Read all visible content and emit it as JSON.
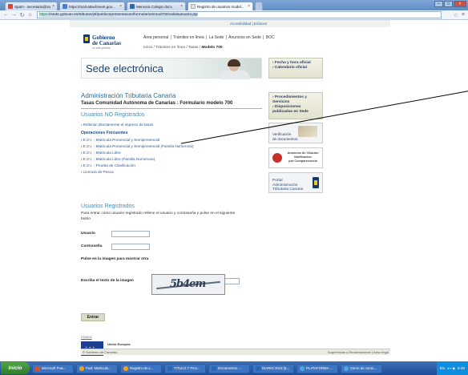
{
  "browser": {
    "tabs": [
      {
        "label": "Spam - secretaria@saladino...",
        "favicon_color": "#d44638"
      },
      {
        "label": "https://mail-attachment.goo...",
        "favicon_color": "#4a7dd1"
      },
      {
        "label": "Memoria Colegio docx",
        "favicon_color": "#2c67b5"
      },
      {
        "label": "Registro de usuarios model...",
        "favicon_color": "#e3e3e3"
      }
    ],
    "url_https": "https",
    "url_rest": "://sede.gobcan.es/tributos/jsf/publico/presentacion/formularios/mod700/validausuario.jsp"
  },
  "site": {
    "access_links": "Accesibilidad | Enlaces",
    "logo": {
      "line1": "Gobierno",
      "line2": "de Canarias",
      "tagline": "un solo pueblo"
    },
    "topnav": [
      "Área personal",
      "Trámites en línea",
      "La Sede",
      "Anuncios en Sede",
      "BOC"
    ],
    "topnav_sep": "|",
    "breadcrumb_prefix": "Inicio / Trámites en línea / Tasas / ",
    "breadcrumb_current": "Modelo 700",
    "banner_title": "Sede electrónica",
    "admin_title": "Administración Tributaria Canaria",
    "form_title": "Tasas Comunidad Autónoma de Canarias : Formulario modelo 700",
    "unregistered_title": "Usuarios NO Registrados",
    "fill_link": "Rellenar directamente el impreso de tasas",
    "frequent_title": "Operaciones Frecuentes",
    "frequent_links": [
      "E.O.I. - Matrícula Presencial y Semipresencial",
      "E.O.I. - Matrícula Presencial y Semipresencial (Familia Numerosa)",
      "E.O.I. - Matrícula Libre",
      "E.O.I. - Matrícula Libre (Familia Numerosa)",
      "E.O.I. - Prueba de Clasificación",
      "Licencia de Pesca"
    ],
    "registered_title": "Usuarios Registrados",
    "registered_para": "Para entrar como usuario registrado rellene el usuario y contraseña y pulse en el siguiente botón",
    "user_label": "Usuario",
    "password_label": "Contraseña",
    "captcha_label": "Pulse en la imagen para mostrar otra",
    "captcha_text": "5b4em",
    "captcha_input_label": "Escriba el texto de la imagen",
    "submit_label": "Entrar",
    "side": {
      "box1": [
        "› Fecha y hora oficial",
        "› Calendario oficial"
      ],
      "box2": [
        "› Procedimientos y Servicios",
        "› Disposiciones publicadas en Sede"
      ],
      "tile_verify": [
        "Verificación",
        "de documentos"
      ],
      "tile_notif": [
        "Anuncios de Citación",
        "Notificación",
        "por Comparecencia"
      ],
      "tile_portal": [
        "Portal",
        "Administración",
        "Tributaria Canaria"
      ]
    },
    "eu": {
      "small": "FONDOS",
      "title": "Unión Europea",
      "sub1": "Fondo Europeo",
      "sub2": "de Desarrollo Regional"
    },
    "updated": "Actualizado: 06/08/2013",
    "footer_left": "© Gobierno de Canarias",
    "footer_right": "Sugerencias y Reclamaciones | Aviso legal"
  },
  "taskbar": {
    "start": "Inicio",
    "tasks": [
      {
        "label": "Microsoft Pow...",
        "color": "#d35230"
      },
      {
        "label": "Fwd: Matricula...",
        "color": "#f2a30f"
      },
      {
        "label": "Registro de u...",
        "color": "#f2a30f"
      },
      {
        "label": "TITULO Y PAU...",
        "color": "#2c67b5"
      },
      {
        "label": "Documento1 -...",
        "color": "#2c67b5"
      },
      {
        "label": "DIARIO 2013 (5...",
        "color": "#2c67b5"
      },
      {
        "label": "PLATAFORMA ...",
        "color": "#4ea8de"
      },
      {
        "label": "Cierre de curso...",
        "color": "#4ea8de"
      }
    ],
    "lang": "ES",
    "clock": "9:46"
  }
}
